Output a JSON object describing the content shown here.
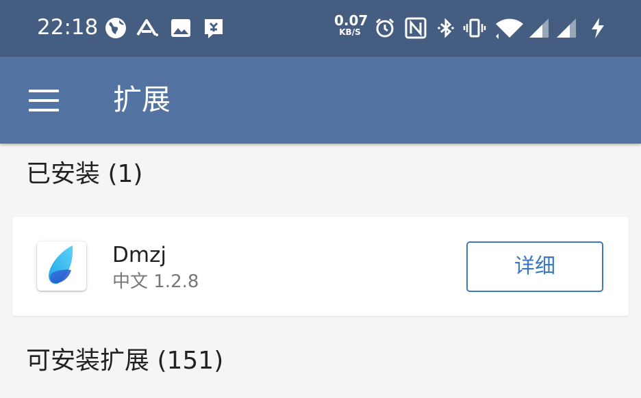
{
  "status_bar": {
    "time": "22:18",
    "net_speed_value": "0.07",
    "net_speed_unit": "KB/S",
    "left_icons": [
      "globe-icon",
      "triangle-a-icon",
      "image-icon",
      "mastodon-icon"
    ],
    "right_icons": [
      "alarm-icon",
      "nfc-icon",
      "bluetooth-icon",
      "vibrate-icon",
      "wifi-icon",
      "signal-icon",
      "signal-icon-2",
      "charging-icon"
    ]
  },
  "toolbar": {
    "menu_icon": "hamburger-menu-icon",
    "title": "扩展",
    "bg_color": "#5373a2"
  },
  "installed_section": {
    "header": "已安装 (1)",
    "items": [
      {
        "name": "Dmzj",
        "meta": "中文 1.2.8",
        "icon": "dmzj-feather-icon",
        "button_label": "详细"
      }
    ]
  },
  "available_section": {
    "header": "可安装扩展 (151)"
  },
  "colors": {
    "status_bar": "#455d80",
    "toolbar": "#5373a2",
    "accent": "#3b78c4",
    "background": "#f5f5f5"
  }
}
